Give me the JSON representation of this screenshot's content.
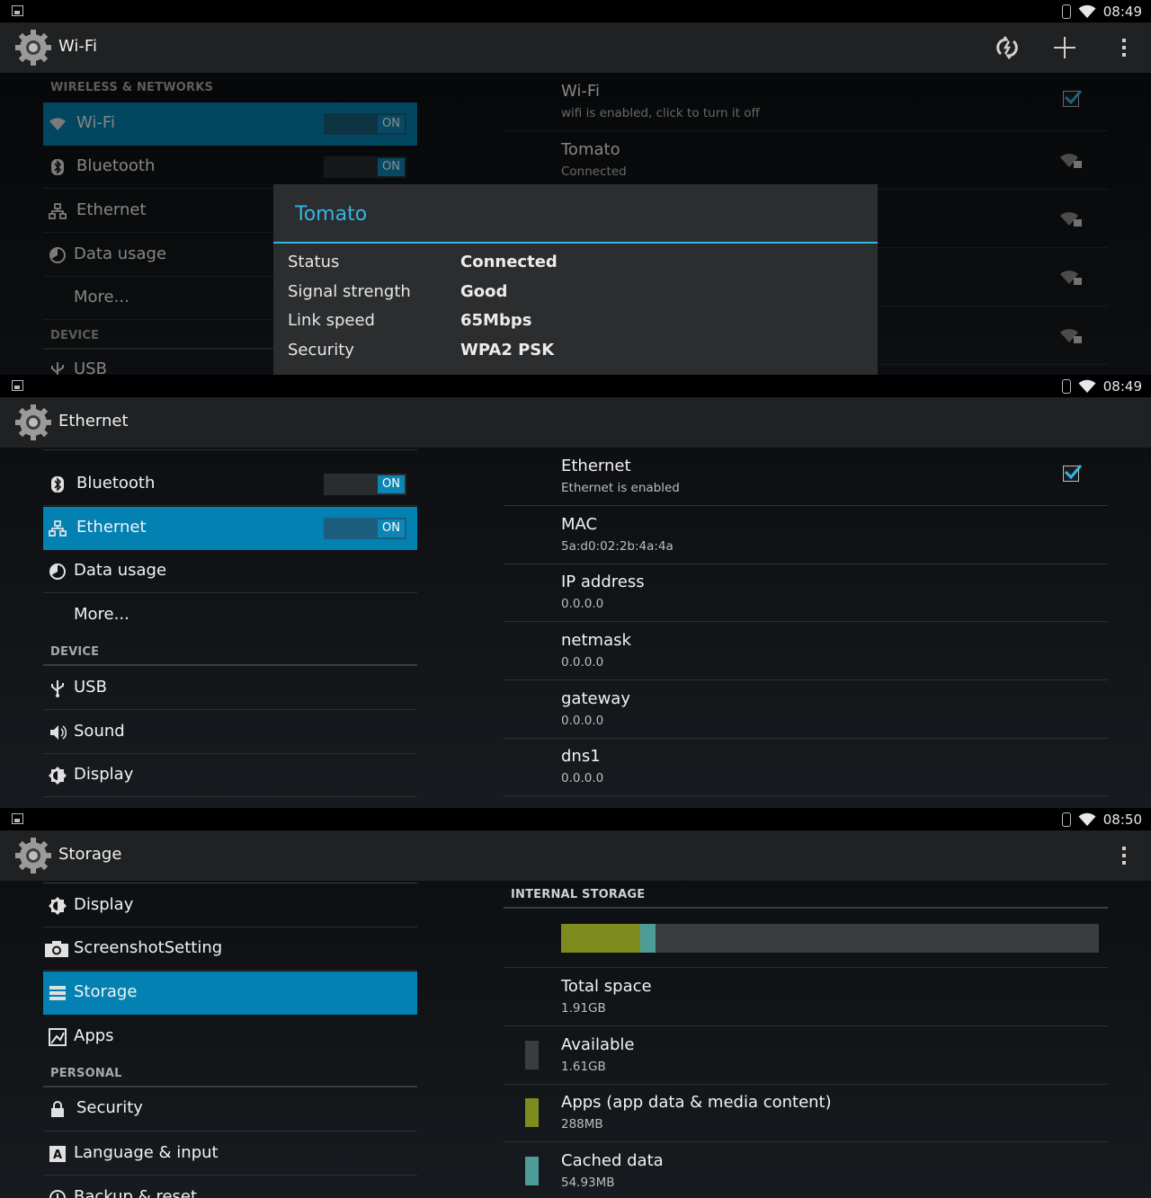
{
  "colors": {
    "accent": "#0381b3",
    "holo_blue": "#33b5e5",
    "apps_color": "#7e8b1e",
    "cache_color": "#4d9c98",
    "available_color": "#3a3c3e"
  },
  "wifi_screen": {
    "status_time": "08:49",
    "title": "Wi-Fi",
    "actions": [
      "wps-icon",
      "add-network-icon",
      "overflow-menu-icon"
    ],
    "category_wireless": "WIRELESS & NETWORKS",
    "category_device": "DEVICE",
    "nav": {
      "wifi": {
        "label": "Wi-Fi",
        "toggle": "ON"
      },
      "bluetooth": {
        "label": "Bluetooth",
        "toggle": "ON"
      },
      "ethernet": {
        "label": "Ethernet"
      },
      "data_usage": {
        "label": "Data usage"
      },
      "more": {
        "label": "More..."
      },
      "usb": {
        "label": "USB"
      }
    },
    "wifi_pref": {
      "title": "Wi-Fi",
      "summary": "wifi is enabled, click to turn it off"
    },
    "network": {
      "title": "Tomato",
      "summary": "Connected"
    },
    "dialog": {
      "title": "Tomato",
      "rows": [
        {
          "key": "Status",
          "value": "Connected"
        },
        {
          "key": "Signal strength",
          "value": "Good"
        },
        {
          "key": "Link speed",
          "value": "65Mbps"
        },
        {
          "key": "Security",
          "value": "WPA2 PSK"
        }
      ]
    }
  },
  "ethernet_screen": {
    "status_time": "08:49",
    "title": "Ethernet",
    "category_device": "DEVICE",
    "nav": {
      "bluetooth": {
        "label": "Bluetooth",
        "toggle": "ON"
      },
      "ethernet": {
        "label": "Ethernet",
        "toggle": "ON"
      },
      "data_usage": {
        "label": "Data usage"
      },
      "more": {
        "label": "More..."
      },
      "usb": {
        "label": "USB"
      },
      "sound": {
        "label": "Sound"
      },
      "display": {
        "label": "Display"
      }
    },
    "prefs": [
      {
        "title": "Ethernet",
        "summary": "Ethernet is enabled"
      },
      {
        "title": "MAC",
        "summary": "5a:d0:02:2b:4a:4a"
      },
      {
        "title": "IP address",
        "summary": "0.0.0.0"
      },
      {
        "title": "netmask",
        "summary": "0.0.0.0"
      },
      {
        "title": "gateway",
        "summary": "0.0.0.0"
      },
      {
        "title": "dns1",
        "summary": "0.0.0.0"
      }
    ]
  },
  "storage_screen": {
    "status_time": "08:50",
    "title": "Storage",
    "category_personal": "PERSONAL",
    "nav": {
      "display": {
        "label": "Display"
      },
      "screenshot": {
        "label": "ScreenshotSetting"
      },
      "storage": {
        "label": "Storage"
      },
      "apps": {
        "label": "Apps"
      },
      "security": {
        "label": "Security"
      },
      "language": {
        "label": "Language & input"
      },
      "backup": {
        "label": "Backup & reset"
      }
    },
    "section_header": "INTERNAL STORAGE",
    "usage": {
      "apps_fraction": 0.147,
      "cache_fraction": 0.028
    },
    "prefs": [
      {
        "title": "Total space",
        "summary": "1.91GB"
      },
      {
        "title": "Available",
        "summary": "1.61GB"
      },
      {
        "title": "Apps (app data & media content)",
        "summary": "288MB"
      },
      {
        "title": "Cached data",
        "summary": "54.93MB"
      }
    ]
  }
}
